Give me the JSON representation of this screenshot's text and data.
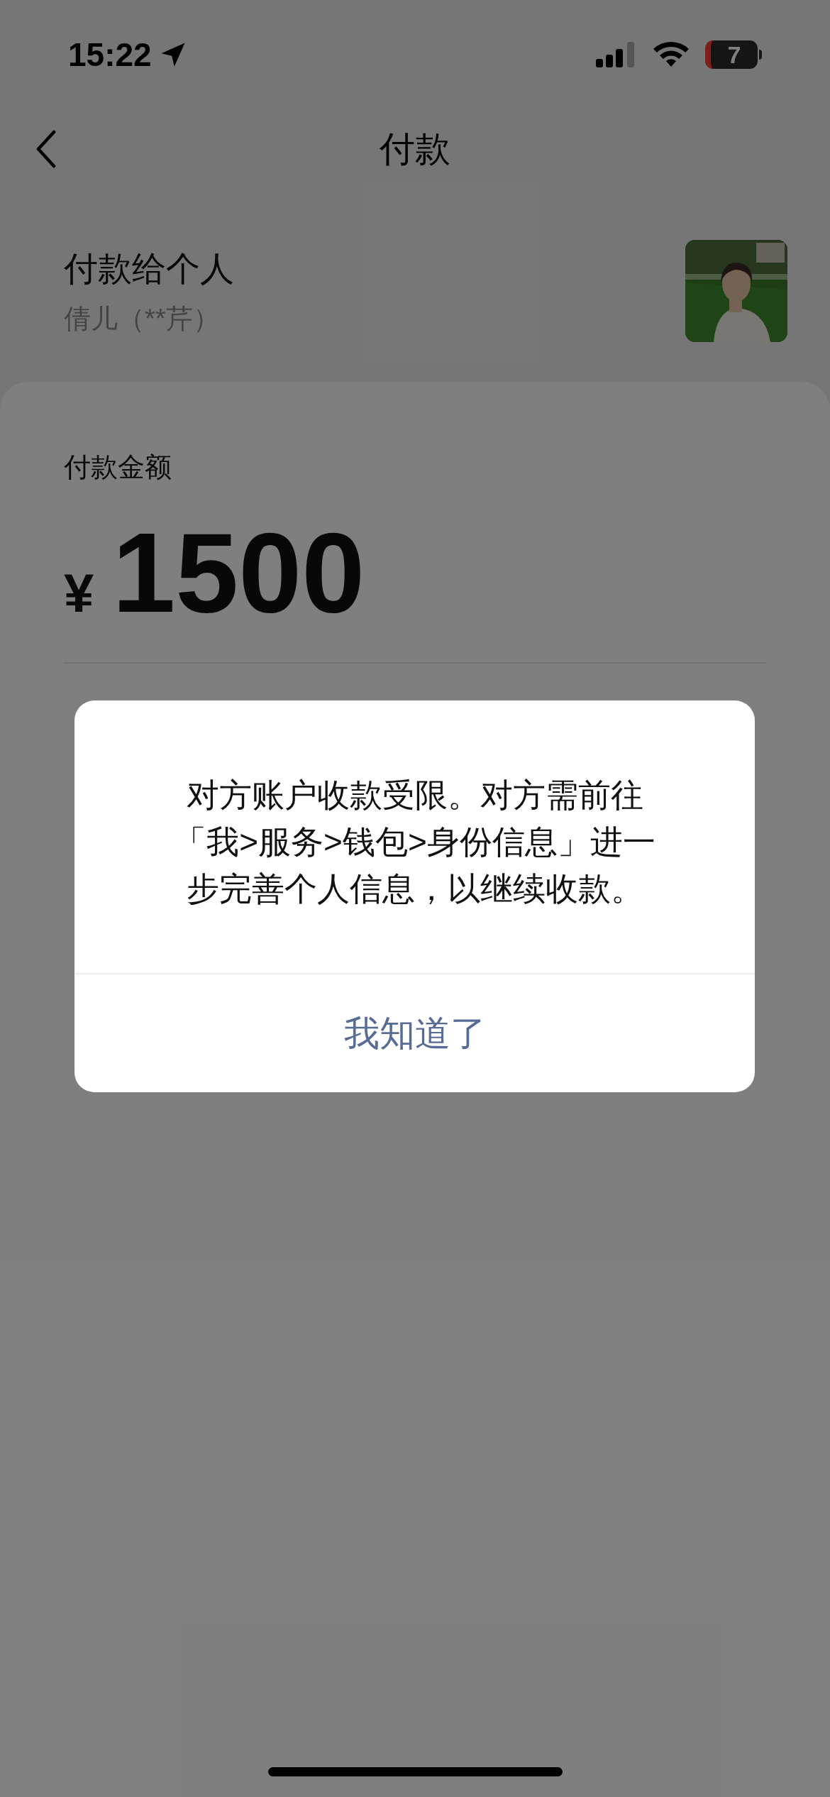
{
  "status_bar": {
    "time": "15:22",
    "battery": "7"
  },
  "nav": {
    "title": "付款"
  },
  "payee": {
    "heading": "付款给个人",
    "name": "倩儿（**芹）"
  },
  "amount": {
    "label": "付款金额",
    "currency": "¥",
    "value": "1500"
  },
  "dialog": {
    "message": "对方账户收款受限。对方需前往「我>服务>钱包>身份信息」进一步完善个人信息，以继续收款。",
    "button": "我知道了"
  }
}
